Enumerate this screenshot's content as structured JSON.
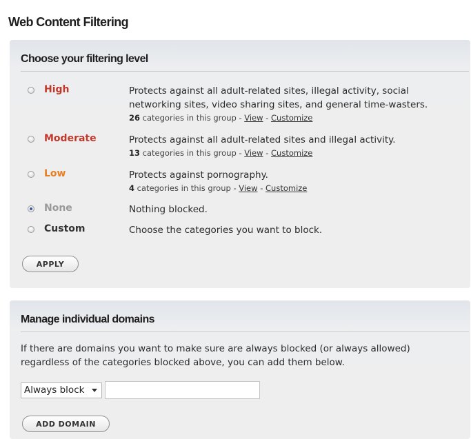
{
  "page": {
    "title": "Web Content Filtering"
  },
  "filtering": {
    "heading": "Choose your filtering level",
    "levels": [
      {
        "label": "High",
        "color": "#c0392b",
        "description": "Protects against all adult-related sites, illegal activity, social networking sites, video sharing sites, and general time-wasters.",
        "count": "26",
        "count_suffix": " categories in this group - ",
        "view_label": "View",
        "separator": " - ",
        "customize_label": "Customize",
        "selected": false
      },
      {
        "label": "Moderate",
        "color": "#c0392b",
        "description": "Protects against all adult-related sites and illegal activity.",
        "count": "13",
        "count_suffix": " categories in this group - ",
        "view_label": "View",
        "separator": " - ",
        "customize_label": "Customize",
        "selected": false
      },
      {
        "label": "Low",
        "color": "#e67e22",
        "description": "Protects against pornography.",
        "count": "4",
        "count_suffix": " categories in this group - ",
        "view_label": "View",
        "separator": " - ",
        "customize_label": "Customize",
        "selected": false
      },
      {
        "label": "None",
        "color": "#999999",
        "description": "Nothing blocked.",
        "selected": true
      },
      {
        "label": "Custom",
        "color": "#333333",
        "description": "Choose the categories you want to block.",
        "selected": false
      }
    ],
    "apply_label": "APPLY"
  },
  "domains": {
    "heading": "Manage individual domains",
    "description": "If there are domains you want to make sure are always blocked (or always allowed) regardless of the categories blocked above, you can add them below.",
    "mode_selected": "Always block",
    "domain_value": "",
    "add_label": "ADD DOMAIN"
  }
}
